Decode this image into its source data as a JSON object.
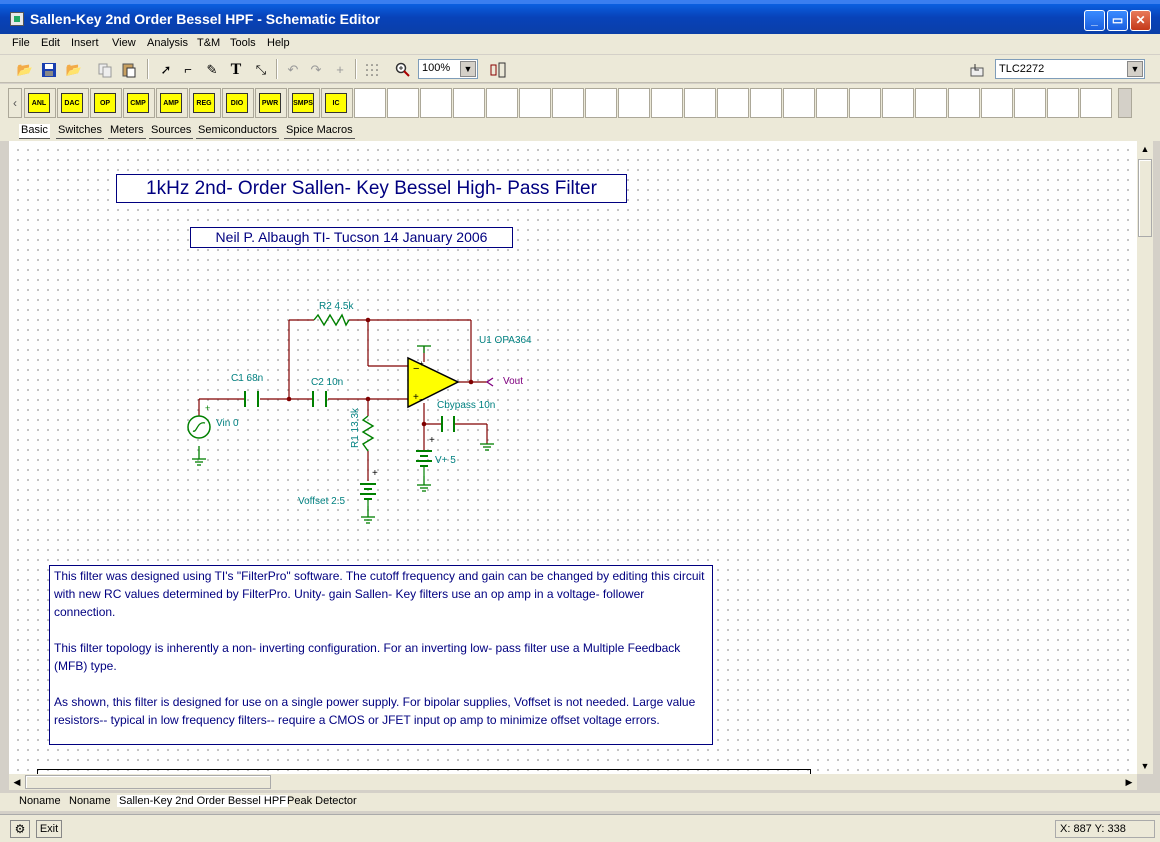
{
  "window": {
    "title": "Sallen-Key 2nd Order Bessel HPF - Schematic Editor",
    "buttons": {
      "minimize": "_",
      "restore": "▭",
      "close": "✕"
    }
  },
  "menu": [
    "File",
    "Edit",
    "Insert",
    "View",
    "Analysis",
    "T&M",
    "Tools",
    "Help"
  ],
  "toolbar": {
    "zoom": "100%",
    "part_name": "TLC2272",
    "icons": [
      "open-folder-icon",
      "save-icon",
      "open-icon",
      "copy-icon",
      "paste-icon",
      "pointer-icon",
      "wire-icon",
      "pencil-icon",
      "text-icon",
      "delete-wire-icon",
      "undo-icon",
      "redo-icon",
      "cross-icon",
      "grid-icon",
      "zoom-icon",
      "hierarchy-icon"
    ]
  },
  "component_toolbar": {
    "items": [
      "ANL",
      "DAC",
      "OP",
      "CMP",
      "AMP",
      "REG",
      "DIO",
      "PWR",
      "SMPS",
      "IC"
    ]
  },
  "palette_tabs": [
    "Basic",
    "Switches",
    "Meters",
    "Sources",
    "Semiconductors",
    "Spice Macros"
  ],
  "schematic": {
    "title": "1kHz 2nd- Order Sallen- Key Bessel High- Pass Filter",
    "author": "Neil P. Albaugh  TI- Tucson  14 January 2006",
    "labels": {
      "r2": "R2 4.5k",
      "u1": "U1 OPA364",
      "c1": "C1 68n",
      "c2": "C2 10n",
      "vout": "Vout",
      "r1": "R1 13.3k",
      "cbypass": "Cbypass 10n",
      "vin": "Vin 0",
      "vplus": "V+ 5",
      "voffset": "Voffset 2.5"
    },
    "description": [
      "This filter was designed using TI's \"FilterPro\" software. The cutoff frequency and gain can be changed by editing this circuit with new RC values determined by FilterPro. Unity- gain Sallen- Key filters use an op amp in a voltage- follower connection.",
      "This filter topology is inherently a non- inverting configuration. For an inverting low- pass filter use a Multiple Feedback (MFB) type.",
      "As shown, this filter is designed for use on a single power supply. For bipolar supplies, Voffset is not needed. Large value resistors-- typical in low frequency filters-- require a CMOS or JFET input op amp to minimize offset voltage errors."
    ]
  },
  "sheet_tabs": [
    "Noname",
    "Noname",
    "Sallen-Key 2nd Order Bessel HPF",
    "Peak Detector"
  ],
  "status": {
    "exit": "Exit",
    "coords": "X: 887  Y: 338"
  },
  "colors": {
    "titlebar": "#0842b8",
    "schematic_text": "#000080",
    "label_teal": "#008080",
    "opamp_fill": "#ffff00",
    "wire": "#800000",
    "ground": "#008000"
  }
}
